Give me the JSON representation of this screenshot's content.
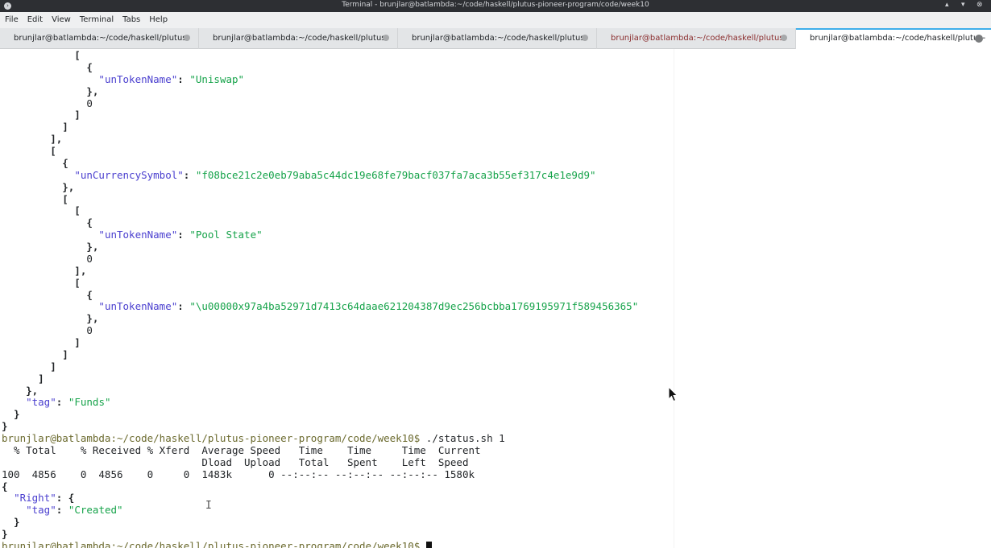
{
  "window": {
    "title": "Terminal - brunjlar@batlambda:~/code/haskell/plutus-pioneer-program/code/week10",
    "app_icon": "terminal-icon",
    "buttons": {
      "minimize": "▴",
      "maximize": "▾",
      "close": "⊗"
    }
  },
  "menu": {
    "items": [
      "File",
      "Edit",
      "View",
      "Terminal",
      "Tabs",
      "Help"
    ]
  },
  "tabs": [
    {
      "label": "brunjlar@batlambda:~/code/haskell/plutus",
      "state": "normal"
    },
    {
      "label": "brunjlar@batlambda:~/code/haskell/plutus",
      "state": "normal"
    },
    {
      "label": "brunjlar@batlambda:~/code/haskell/plutus",
      "state": "normal"
    },
    {
      "label": "brunjlar@batlambda:~/code/haskell/plutus",
      "state": "alert"
    },
    {
      "label": "brunjlar@batlambda:~/code/haskell/plutus-p...",
      "state": "active"
    }
  ],
  "terminal": {
    "lines": [
      [
        [
          "pun",
          "            ["
        ]
      ],
      [
        [
          "pun",
          "              {"
        ]
      ],
      [
        [
          "",
          "                "
        ],
        [
          "key",
          "\"unTokenName\""
        ],
        [
          "pun",
          ": "
        ],
        [
          "str",
          "\"Uniswap\""
        ]
      ],
      [
        [
          "pun",
          "              },"
        ]
      ],
      [
        [
          "num",
          "              0"
        ]
      ],
      [
        [
          "pun",
          "            ]"
        ]
      ],
      [
        [
          "pun",
          "          ]"
        ]
      ],
      [
        [
          "pun",
          "        ],"
        ]
      ],
      [
        [
          "pun",
          "        ["
        ]
      ],
      [
        [
          "pun",
          "          {"
        ]
      ],
      [
        [
          "",
          "            "
        ],
        [
          "key",
          "\"unCurrencySymbol\""
        ],
        [
          "pun",
          ": "
        ],
        [
          "str",
          "\"f08bce21c2e0eb79aba5c44dc19e68fe79bacf037fa7aca3b55ef317c4e1e9d9\""
        ]
      ],
      [
        [
          "pun",
          "          },"
        ]
      ],
      [
        [
          "pun",
          "          ["
        ]
      ],
      [
        [
          "pun",
          "            ["
        ]
      ],
      [
        [
          "pun",
          "              {"
        ]
      ],
      [
        [
          "",
          "                "
        ],
        [
          "key",
          "\"unTokenName\""
        ],
        [
          "pun",
          ": "
        ],
        [
          "str",
          "\"Pool State\""
        ]
      ],
      [
        [
          "pun",
          "              },"
        ]
      ],
      [
        [
          "num",
          "              0"
        ]
      ],
      [
        [
          "pun",
          "            ],"
        ]
      ],
      [
        [
          "pun",
          "            ["
        ]
      ],
      [
        [
          "pun",
          "              {"
        ]
      ],
      [
        [
          "",
          "                "
        ],
        [
          "key",
          "\"unTokenName\""
        ],
        [
          "pun",
          ": "
        ],
        [
          "str",
          "\"\\u00000x97a4ba52971d7413c64daae621204387d9ec256bcbba1769195971f589456365\""
        ]
      ],
      [
        [
          "pun",
          "              },"
        ]
      ],
      [
        [
          "num",
          "              0"
        ]
      ],
      [
        [
          "pun",
          "            ]"
        ]
      ],
      [
        [
          "pun",
          "          ]"
        ]
      ],
      [
        [
          "pun",
          "        ]"
        ]
      ],
      [
        [
          "pun",
          "      ]"
        ]
      ],
      [
        [
          "pun",
          "    },"
        ]
      ],
      [
        [
          "",
          "    "
        ],
        [
          "key",
          "\"tag\""
        ],
        [
          "pun",
          ": "
        ],
        [
          "str",
          "\"Funds\""
        ]
      ],
      [
        [
          "pun",
          "  }"
        ]
      ],
      [
        [
          "pun",
          "}"
        ]
      ],
      [
        [
          "prompt",
          "brunjlar@batlambda:~/code/haskell/plutus-pioneer-program/code/week10$"
        ],
        [
          "cmd",
          " ./status.sh 1"
        ]
      ],
      [
        [
          "cmd",
          "  % Total    % Received % Xferd  Average Speed   Time    Time     Time  Current"
        ]
      ],
      [
        [
          "cmd",
          "                                 Dload  Upload   Total   Spent    Left  Speed"
        ]
      ],
      [
        [
          "cmd",
          "100  4856    0  4856    0     0  1483k      0 --:--:-- --:--:-- --:--:-- 1580k"
        ]
      ],
      [
        [
          "pun",
          "{"
        ]
      ],
      [
        [
          "",
          "  "
        ],
        [
          "key",
          "\"Right\""
        ],
        [
          "pun",
          ": {"
        ]
      ],
      [
        [
          "",
          "    "
        ],
        [
          "key",
          "\"tag\""
        ],
        [
          "pun",
          ": "
        ],
        [
          "str",
          "\"Created\""
        ]
      ],
      [
        [
          "pun",
          "  }"
        ]
      ],
      [
        [
          "pun",
          "}"
        ]
      ],
      [
        [
          "prompt",
          "brunjlar@batlambda:~/code/haskell/plutus-pioneer-program/code/week10$"
        ],
        [
          "cmd",
          " "
        ]
      ]
    ]
  },
  "pointer_icon": "mouse-arrow-icon",
  "ibeam_icon": "text-ibeam-icon"
}
